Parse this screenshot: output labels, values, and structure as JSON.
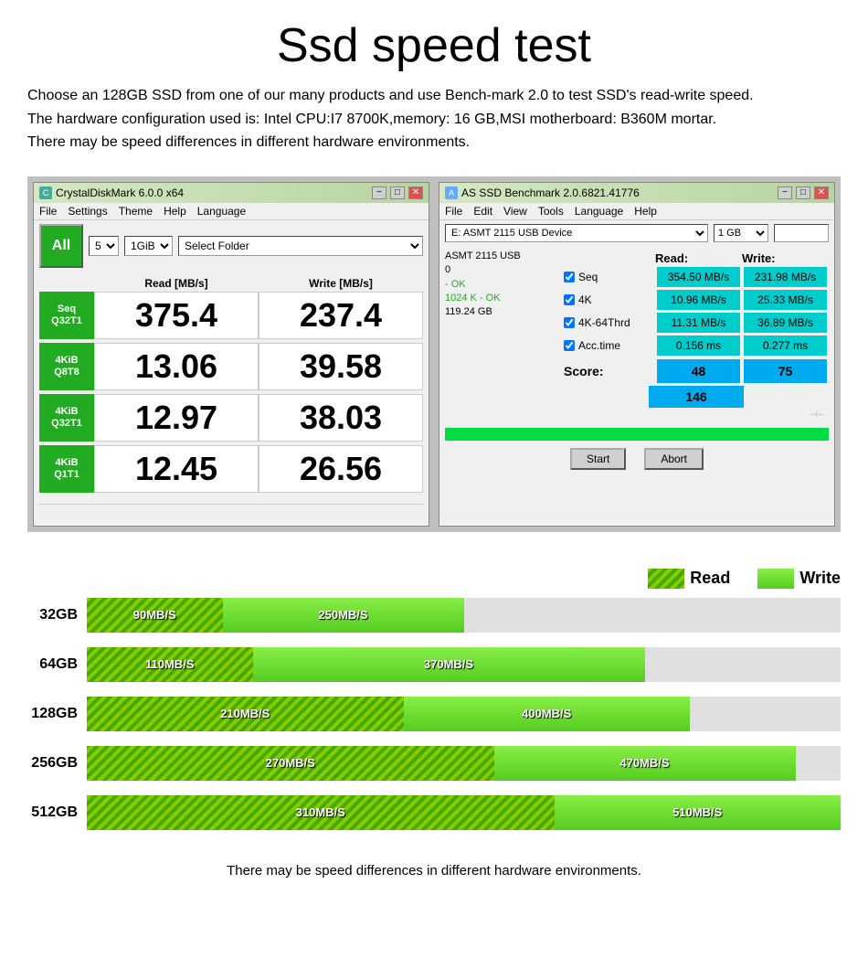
{
  "page": {
    "title": "Ssd speed test",
    "description_lines": [
      "Choose an 128GB SSD from one of our many products and use Bench-mark 2.0 to test SSD's read-write speed.",
      "The hardware configuration used is: Intel CPU:I7 8700K,memory: 16 GB,MSI motherboard: B360M mortar.",
      "There may be speed differences in different hardware environments."
    ],
    "footer_note": "There may be speed differences in different hardware environments."
  },
  "cdm": {
    "title": "CrystalDiskMark 6.0.0 x64",
    "app_icon": "C",
    "menu_items": [
      "File",
      "Settings",
      "Theme",
      "Help",
      "Language"
    ],
    "all_btn": "All",
    "count_select": "5",
    "size_select": "1GiB",
    "folder_select": "Select Folder",
    "read_header": "Read [MB/s]",
    "write_header": "Write [MB/s]",
    "rows": [
      {
        "label": "Seq\nQ32T1",
        "read": "375.4",
        "write": "237.4"
      },
      {
        "label": "4KiB\nQ8T8",
        "read": "13.06",
        "write": "39.58"
      },
      {
        "label": "4KiB\nQ32T1",
        "read": "12.97",
        "write": "38.03"
      },
      {
        "label": "4KiB\nQ1T1",
        "read": "12.45",
        "write": "26.56"
      }
    ]
  },
  "asssd": {
    "title": "AS SSD Benchmark 2.0.6821.41776",
    "menu_items": [
      "File",
      "Edit",
      "View",
      "Tools",
      "Language",
      "Help"
    ],
    "device_select": "E: ASMT 2115 USB Device",
    "size_select": "1 GB",
    "device_info": {
      "name": "ASMT 2115 USB",
      "value": "0",
      "status1": "- OK",
      "status2": "1024 K - OK",
      "size": "119.24 GB"
    },
    "read_header": "Read:",
    "write_header": "Write:",
    "rows": [
      {
        "label": "Seq",
        "read": "354.50 MB/s",
        "write": "231.98 MB/s"
      },
      {
        "label": "4K",
        "read": "10.96 MB/s",
        "write": "25.33 MB/s"
      },
      {
        "label": "4K-64Thrd",
        "read": "11.31 MB/s",
        "write": "36.89 MB/s"
      },
      {
        "label": "Acc.time",
        "read": "0.156 ms",
        "write": "0.277 ms"
      }
    ],
    "score_label": "Score:",
    "score_read": "48",
    "score_write": "75",
    "score_total": "146",
    "timestamp": "--/--",
    "start_btn": "Start",
    "abort_btn": "Abort"
  },
  "barchart": {
    "rows": [
      {
        "size": "32GB",
        "read_label": "90MB/S",
        "write_label": "250MB/S",
        "read_pct": 18,
        "write_pct": 50
      },
      {
        "size": "64GB",
        "read_label": "110MB/S",
        "write_label": "370MB/S",
        "read_pct": 22,
        "write_pct": 74
      },
      {
        "size": "128GB",
        "read_label": "210MB/S",
        "write_label": "400MB/S",
        "read_pct": 42,
        "write_pct": 80
      },
      {
        "size": "256GB",
        "read_label": "270MB/S",
        "write_label": "470MB/S",
        "read_pct": 54,
        "write_pct": 94
      },
      {
        "size": "512GB",
        "read_label": "310MB/S",
        "write_label": "510MB/S",
        "read_pct": 62,
        "write_pct": 100
      }
    ],
    "legend_read": "Read",
    "legend_write": "Write"
  }
}
